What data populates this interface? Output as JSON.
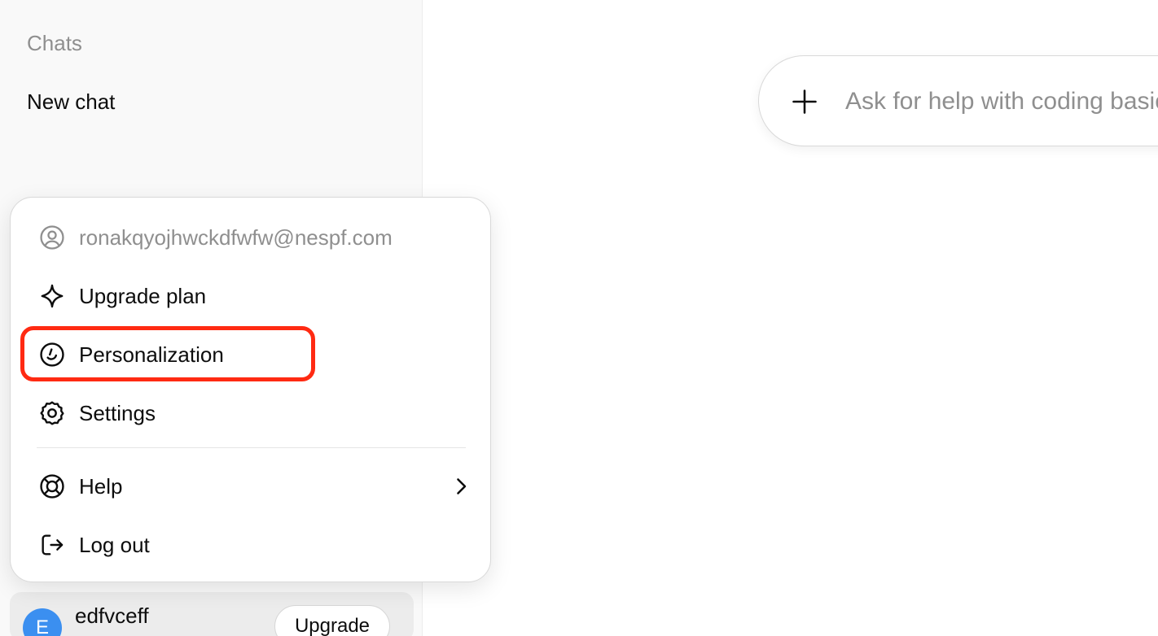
{
  "sidebar": {
    "section_title": "Chats",
    "chat_items": [
      {
        "label": "New chat"
      }
    ]
  },
  "account_menu": {
    "email": "ronakqyojhwckdfwfw@nespf.com",
    "items": [
      {
        "label": "Upgrade plan",
        "icon": "sparkle-icon"
      },
      {
        "label": "Personalization",
        "icon": "personalization-icon",
        "highlighted": true
      },
      {
        "label": "Settings",
        "icon": "gear-icon"
      },
      {
        "label": "Help",
        "icon": "lifebuoy-icon",
        "has_submenu": true
      },
      {
        "label": "Log out",
        "icon": "logout-icon"
      }
    ]
  },
  "account": {
    "avatar_initial": "E",
    "name": "edfvceff",
    "upgrade_label": "Upgrade",
    "avatar_color": "#3b8ff0"
  },
  "composer": {
    "placeholder": "Ask for help with coding basics"
  },
  "colors": {
    "highlight": "#ff2a12",
    "sidebar_bg": "#f9f9f9"
  }
}
